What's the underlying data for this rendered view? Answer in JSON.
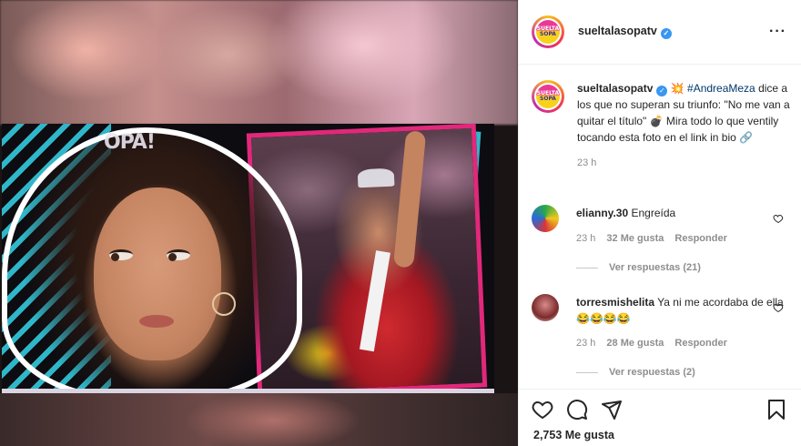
{
  "account": {
    "username": "sueltalasopatv",
    "verified": true,
    "logo_text_top": "SUELTA",
    "logo_text_bottom": "SOPA"
  },
  "media": {
    "watermark_text": "OPA!"
  },
  "caption": {
    "username": "sueltalasopatv",
    "emoji_burst": "💥",
    "hashtag": "#AndreaMeza",
    "text": "dice a los que no superan su triunfo: \"No me van a quitar el título\" 💣 Mira todo lo que ventily tocando esta foto en el link in bio 🔗",
    "time": "23 h"
  },
  "comments": [
    {
      "username": "elianny.30",
      "text": "Engreída",
      "time": "23 h",
      "likes": "32 Me gusta",
      "reply_label": "Responder",
      "view_replies": "Ver respuestas (21)"
    },
    {
      "username": "torresmishelita",
      "text": "Ya ni me acordaba de ella 😂😂😂😂",
      "time": "23 h",
      "likes": "28 Me gusta",
      "reply_label": "Responder",
      "view_replies": "Ver respuestas (2)"
    }
  ],
  "footer": {
    "likes_count": "2,753 Me gusta"
  },
  "icons": {
    "more": "more-options-icon",
    "verified": "verified-badge-icon",
    "like": "heart-icon",
    "comment": "comment-icon",
    "share": "share-icon",
    "save": "bookmark-icon"
  },
  "colors": {
    "accent_pink": "#e2287b",
    "accent_cyan": "#2fb7c9",
    "link_blue": "#00376b",
    "verified_blue": "#3897f0",
    "meta_gray": "#8e8e8e"
  }
}
